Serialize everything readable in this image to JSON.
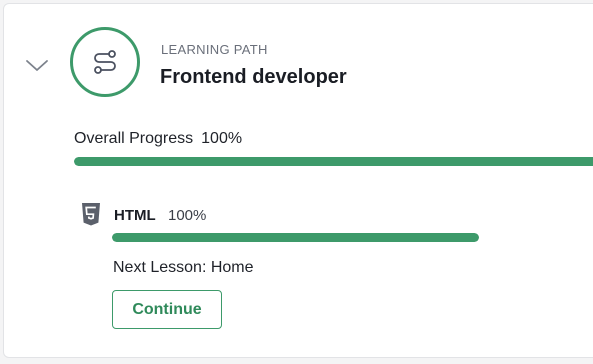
{
  "path": {
    "eyebrow": "LEARNING PATH",
    "title": "Frontend developer",
    "badge_icon": "route-icon",
    "accent_color": "#3d9a6a"
  },
  "overall": {
    "label": "Overall Progress",
    "percent_text": "100%",
    "progress": 1.0
  },
  "course": {
    "icon": "html5-icon",
    "name": "HTML",
    "percent_text": "100%",
    "progress": 1.0,
    "next_lesson_label": "Next Lesson:",
    "next_lesson_name": "Home",
    "continue_label": "Continue"
  }
}
